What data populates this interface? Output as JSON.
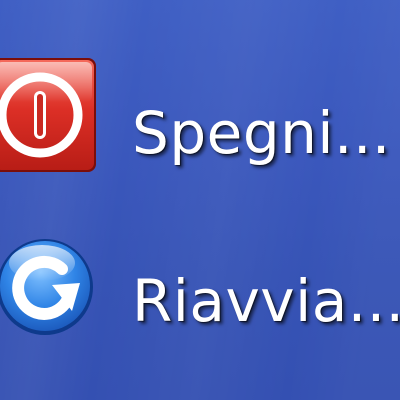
{
  "menu": {
    "items": [
      {
        "label": "Spegni...",
        "icon": "power-icon",
        "icon_color": "#d42a22"
      },
      {
        "label": "Riavvia...",
        "icon": "restart-icon",
        "icon_color": "#2f7fe0"
      }
    ]
  }
}
